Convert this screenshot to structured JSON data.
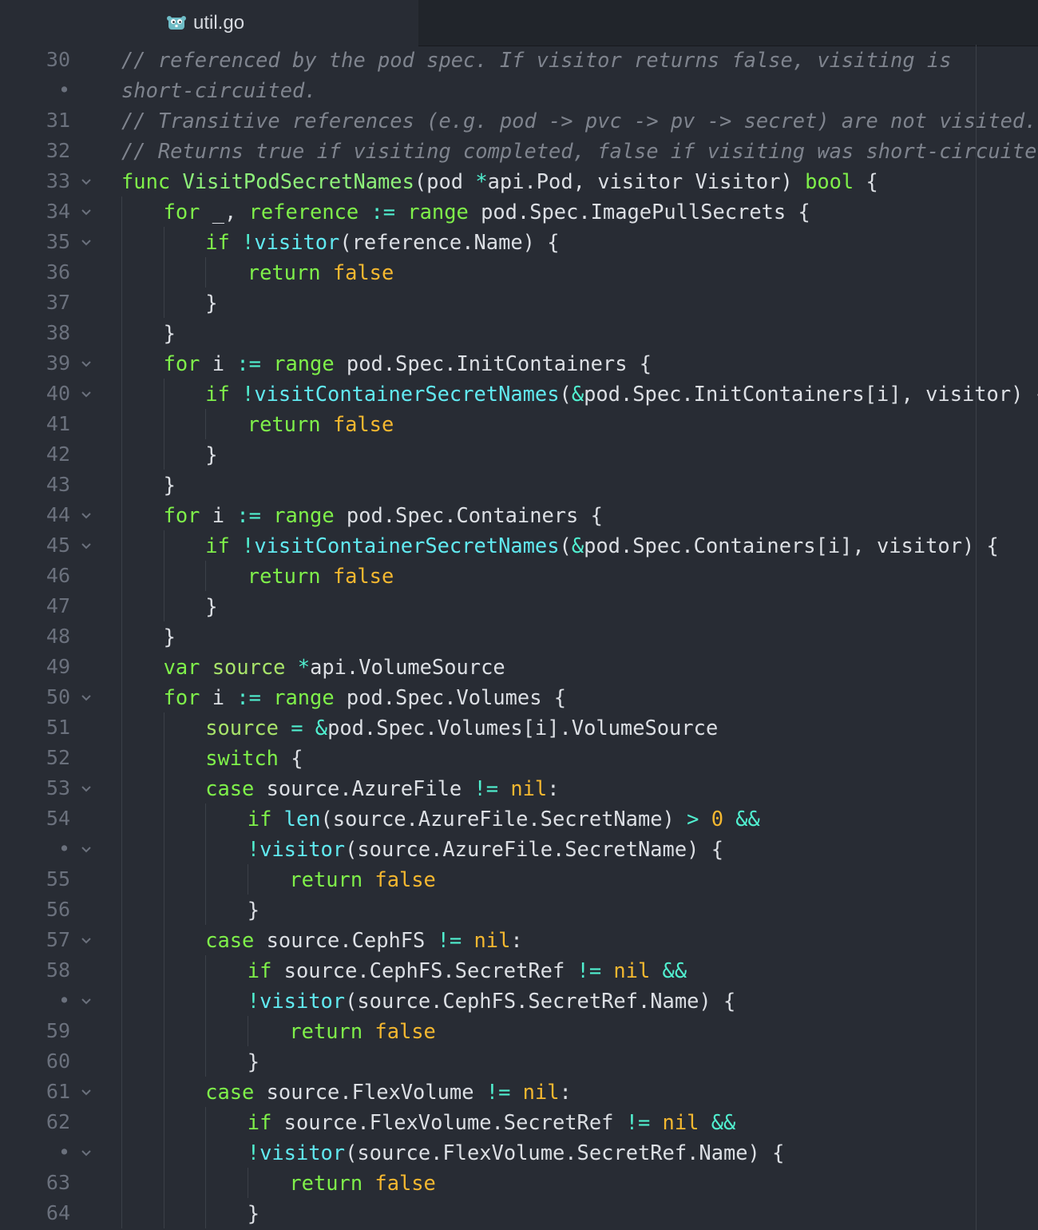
{
  "tab": {
    "label": "util.go",
    "icon": "gopher-icon"
  },
  "colors": {
    "background": "#282c34",
    "comment": "#7f848e",
    "keyword": "#7ff04a",
    "operator": "#51f0d0",
    "boolean": "#f5b830",
    "gutter": "#6b717d",
    "text": "#dcdfe4"
  },
  "lines": [
    {
      "num": "30",
      "fold": false,
      "indent": 0,
      "tokens": [
        [
          "c",
          "// referenced by the pod spec. If visitor returns false, visiting is"
        ]
      ]
    },
    {
      "num": "•",
      "fold": false,
      "indent": 0,
      "tokens": [
        [
          "c",
          "short-circuited."
        ]
      ]
    },
    {
      "num": "31",
      "fold": false,
      "indent": 0,
      "tokens": [
        [
          "c",
          "// Transitive references (e.g. pod -> pvc -> pv -> secret) are not visited."
        ]
      ]
    },
    {
      "num": "32",
      "fold": false,
      "indent": 0,
      "tokens": [
        [
          "c",
          "// Returns true if visiting completed, false if visiting was short-circuited."
        ]
      ]
    },
    {
      "num": "33",
      "fold": true,
      "indent": 0,
      "tokens": [
        [
          "k",
          "func "
        ],
        [
          "f",
          "VisitPodSecretNames"
        ],
        [
          "t",
          "(pod "
        ],
        [
          "o",
          "*"
        ],
        [
          "t",
          "api.Pod, visitor Visitor) "
        ],
        [
          "k",
          "bool"
        ],
        [
          "t",
          " {"
        ]
      ]
    },
    {
      "num": "34",
      "fold": true,
      "indent": 1,
      "tokens": [
        [
          "k",
          "for "
        ],
        [
          "t",
          "_, "
        ],
        [
          "k",
          "reference "
        ],
        [
          "o",
          ":= "
        ],
        [
          "k",
          "range "
        ],
        [
          "t",
          "pod.Spec.ImagePullSecrets {"
        ]
      ]
    },
    {
      "num": "35",
      "fold": true,
      "indent": 2,
      "tokens": [
        [
          "k",
          "if "
        ],
        [
          "o",
          "!"
        ],
        [
          "b",
          "visitor"
        ],
        [
          "t",
          "(reference.Name) {"
        ]
      ]
    },
    {
      "num": "36",
      "fold": false,
      "indent": 3,
      "tokens": [
        [
          "k",
          "return "
        ],
        [
          "v",
          "false"
        ]
      ]
    },
    {
      "num": "37",
      "fold": false,
      "indent": 2,
      "tokens": [
        [
          "t",
          "}"
        ]
      ]
    },
    {
      "num": "38",
      "fold": false,
      "indent": 1,
      "tokens": [
        [
          "t",
          "}"
        ]
      ]
    },
    {
      "num": "39",
      "fold": true,
      "indent": 1,
      "tokens": [
        [
          "k",
          "for "
        ],
        [
          "t",
          "i "
        ],
        [
          "o",
          ":= "
        ],
        [
          "k",
          "range "
        ],
        [
          "t",
          "pod.Spec.InitContainers {"
        ]
      ]
    },
    {
      "num": "40",
      "fold": true,
      "indent": 2,
      "tokens": [
        [
          "k",
          "if "
        ],
        [
          "o",
          "!"
        ],
        [
          "b",
          "visitContainerSecretNames"
        ],
        [
          "t",
          "("
        ],
        [
          "o",
          "&"
        ],
        [
          "t",
          "pod.Spec.InitContainers[i], visitor) {"
        ]
      ]
    },
    {
      "num": "41",
      "fold": false,
      "indent": 3,
      "tokens": [
        [
          "k",
          "return "
        ],
        [
          "v",
          "false"
        ]
      ]
    },
    {
      "num": "42",
      "fold": false,
      "indent": 2,
      "tokens": [
        [
          "t",
          "}"
        ]
      ]
    },
    {
      "num": "43",
      "fold": false,
      "indent": 1,
      "tokens": [
        [
          "t",
          "}"
        ]
      ]
    },
    {
      "num": "44",
      "fold": true,
      "indent": 1,
      "tokens": [
        [
          "k",
          "for "
        ],
        [
          "t",
          "i "
        ],
        [
          "o",
          ":= "
        ],
        [
          "k",
          "range "
        ],
        [
          "t",
          "pod.Spec.Containers {"
        ]
      ]
    },
    {
      "num": "45",
      "fold": true,
      "indent": 2,
      "tokens": [
        [
          "k",
          "if "
        ],
        [
          "o",
          "!"
        ],
        [
          "b",
          "visitContainerSecretNames"
        ],
        [
          "t",
          "("
        ],
        [
          "o",
          "&"
        ],
        [
          "t",
          "pod.Spec.Containers[i], visitor) {"
        ]
      ]
    },
    {
      "num": "46",
      "fold": false,
      "indent": 3,
      "tokens": [
        [
          "k",
          "return "
        ],
        [
          "v",
          "false"
        ]
      ]
    },
    {
      "num": "47",
      "fold": false,
      "indent": 2,
      "tokens": [
        [
          "t",
          "}"
        ]
      ]
    },
    {
      "num": "48",
      "fold": false,
      "indent": 1,
      "tokens": [
        [
          "t",
          "}"
        ]
      ]
    },
    {
      "num": "49",
      "fold": false,
      "indent": 1,
      "tokens": [
        [
          "k",
          "var "
        ],
        [
          "y",
          "source "
        ],
        [
          "o",
          "*"
        ],
        [
          "t",
          "api.VolumeSource"
        ]
      ]
    },
    {
      "num": "50",
      "fold": true,
      "indent": 1,
      "tokens": [
        [
          "k",
          "for "
        ],
        [
          "t",
          "i "
        ],
        [
          "o",
          ":= "
        ],
        [
          "k",
          "range "
        ],
        [
          "t",
          "pod.Spec.Volumes {"
        ]
      ]
    },
    {
      "num": "51",
      "fold": false,
      "indent": 2,
      "tokens": [
        [
          "y",
          "source "
        ],
        [
          "o",
          "= &"
        ],
        [
          "t",
          "pod.Spec.Volumes[i].VolumeSource"
        ]
      ]
    },
    {
      "num": "52",
      "fold": false,
      "indent": 2,
      "tokens": [
        [
          "k",
          "switch "
        ],
        [
          "t",
          "{"
        ]
      ]
    },
    {
      "num": "53",
      "fold": true,
      "indent": 2,
      "tokens": [
        [
          "k",
          "case "
        ],
        [
          "t",
          "source.AzureFile "
        ],
        [
          "o",
          "!= "
        ],
        [
          "v",
          "nil"
        ],
        [
          "t",
          ":"
        ]
      ]
    },
    {
      "num": "54",
      "fold": false,
      "indent": 3,
      "tokens": [
        [
          "k",
          "if "
        ],
        [
          "b",
          "len"
        ],
        [
          "t",
          "(source.AzureFile.SecretName) "
        ],
        [
          "o",
          "> "
        ],
        [
          "n",
          "0 "
        ],
        [
          "o",
          "&&"
        ]
      ]
    },
    {
      "num": "•",
      "fold": true,
      "indent": 3,
      "tokens": [
        [
          "o",
          "!"
        ],
        [
          "b",
          "visitor"
        ],
        [
          "t",
          "(source.AzureFile.SecretName) {"
        ]
      ]
    },
    {
      "num": "55",
      "fold": false,
      "indent": 4,
      "tokens": [
        [
          "k",
          "return "
        ],
        [
          "v",
          "false"
        ]
      ]
    },
    {
      "num": "56",
      "fold": false,
      "indent": 3,
      "tokens": [
        [
          "t",
          "}"
        ]
      ]
    },
    {
      "num": "57",
      "fold": true,
      "indent": 2,
      "tokens": [
        [
          "k",
          "case "
        ],
        [
          "t",
          "source.CephFS "
        ],
        [
          "o",
          "!= "
        ],
        [
          "v",
          "nil"
        ],
        [
          "t",
          ":"
        ]
      ]
    },
    {
      "num": "58",
      "fold": false,
      "indent": 3,
      "tokens": [
        [
          "k",
          "if "
        ],
        [
          "t",
          "source.CephFS.SecretRef "
        ],
        [
          "o",
          "!= "
        ],
        [
          "v",
          "nil "
        ],
        [
          "o",
          "&&"
        ]
      ]
    },
    {
      "num": "•",
      "fold": true,
      "indent": 3,
      "tokens": [
        [
          "o",
          "!"
        ],
        [
          "b",
          "visitor"
        ],
        [
          "t",
          "(source.CephFS.SecretRef.Name) {"
        ]
      ]
    },
    {
      "num": "59",
      "fold": false,
      "indent": 4,
      "tokens": [
        [
          "k",
          "return "
        ],
        [
          "v",
          "false"
        ]
      ]
    },
    {
      "num": "60",
      "fold": false,
      "indent": 3,
      "tokens": [
        [
          "t",
          "}"
        ]
      ]
    },
    {
      "num": "61",
      "fold": true,
      "indent": 2,
      "tokens": [
        [
          "k",
          "case "
        ],
        [
          "t",
          "source.FlexVolume "
        ],
        [
          "o",
          "!= "
        ],
        [
          "v",
          "nil"
        ],
        [
          "t",
          ":"
        ]
      ]
    },
    {
      "num": "62",
      "fold": false,
      "indent": 3,
      "tokens": [
        [
          "k",
          "if "
        ],
        [
          "t",
          "source.FlexVolume.SecretRef "
        ],
        [
          "o",
          "!= "
        ],
        [
          "v",
          "nil "
        ],
        [
          "o",
          "&&"
        ]
      ]
    },
    {
      "num": "•",
      "fold": true,
      "indent": 3,
      "tokens": [
        [
          "o",
          "!"
        ],
        [
          "b",
          "visitor"
        ],
        [
          "t",
          "(source.FlexVolume.SecretRef.Name) {"
        ]
      ]
    },
    {
      "num": "63",
      "fold": false,
      "indent": 4,
      "tokens": [
        [
          "k",
          "return "
        ],
        [
          "v",
          "false"
        ]
      ]
    },
    {
      "num": "64",
      "fold": false,
      "indent": 3,
      "tokens": [
        [
          "t",
          "}"
        ]
      ]
    }
  ]
}
